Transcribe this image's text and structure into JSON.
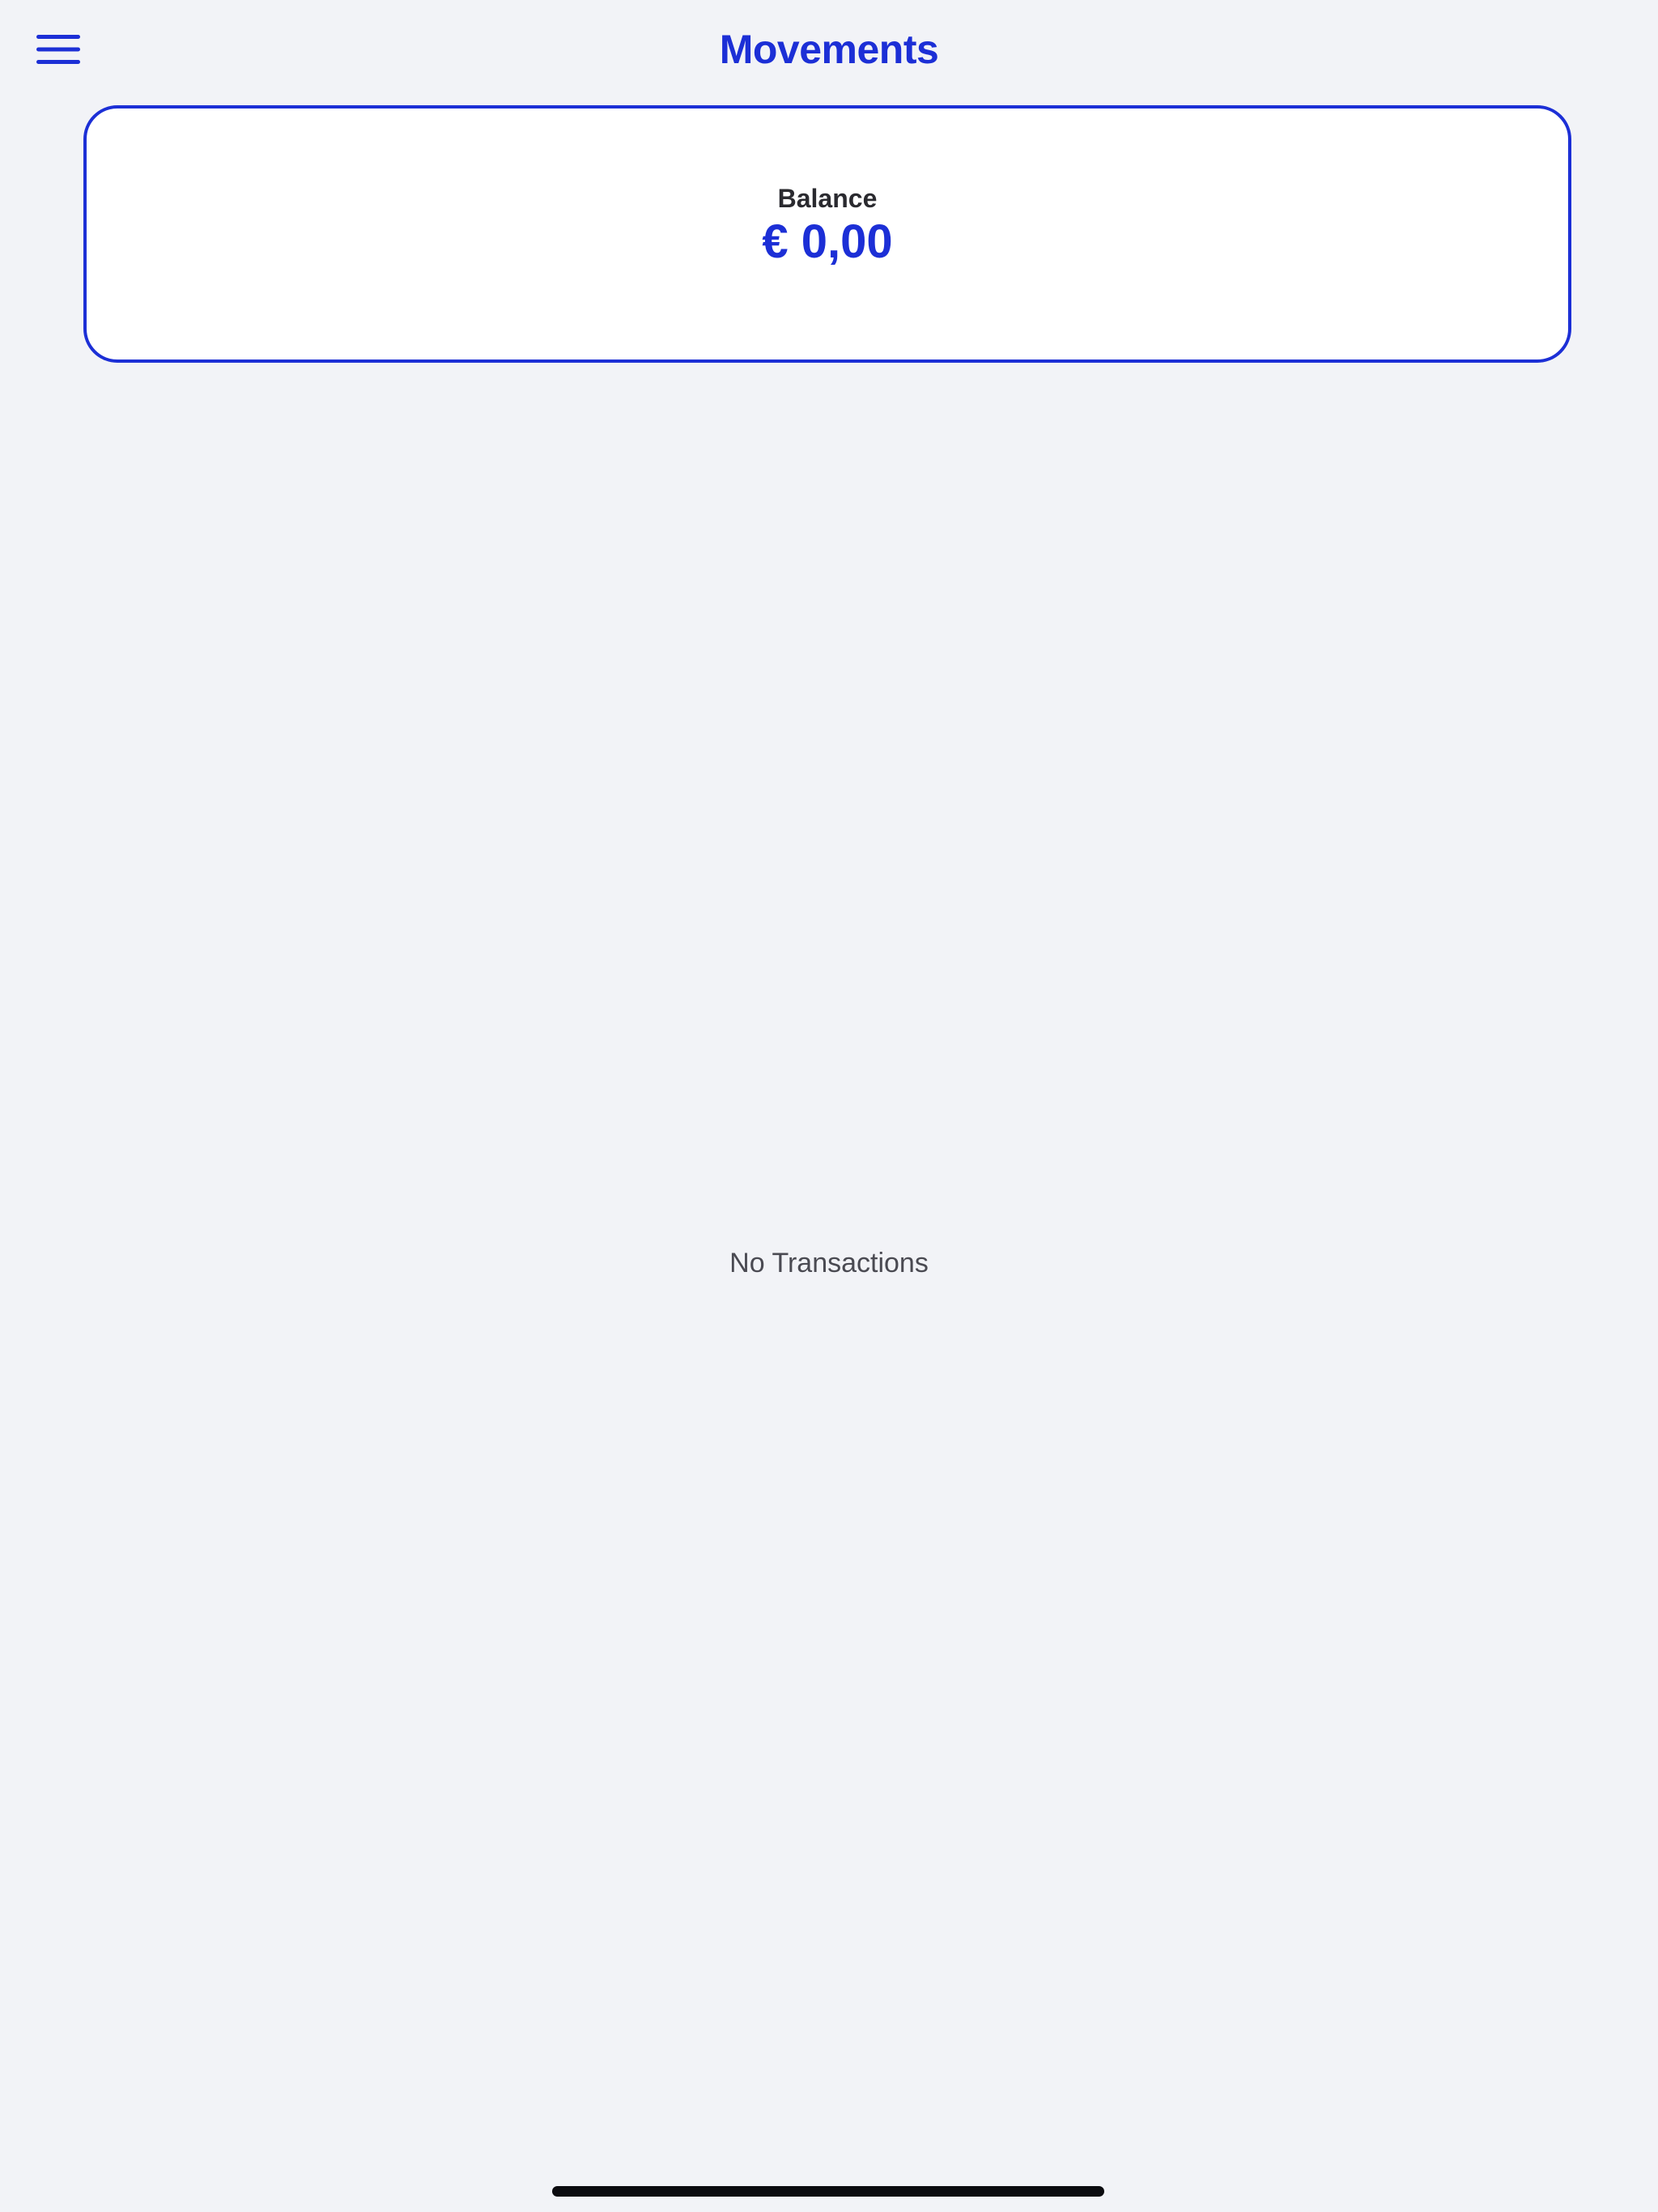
{
  "header": {
    "title": "Movements",
    "menu_icon": "hamburger-menu-icon"
  },
  "balance_card": {
    "label": "Balance",
    "amount": "€ 0,00"
  },
  "transactions": {
    "empty_text": "No Transactions"
  },
  "colors": {
    "accent": "#1c2fd6",
    "background": "#f2f3f7",
    "card_background": "#ffffff"
  }
}
